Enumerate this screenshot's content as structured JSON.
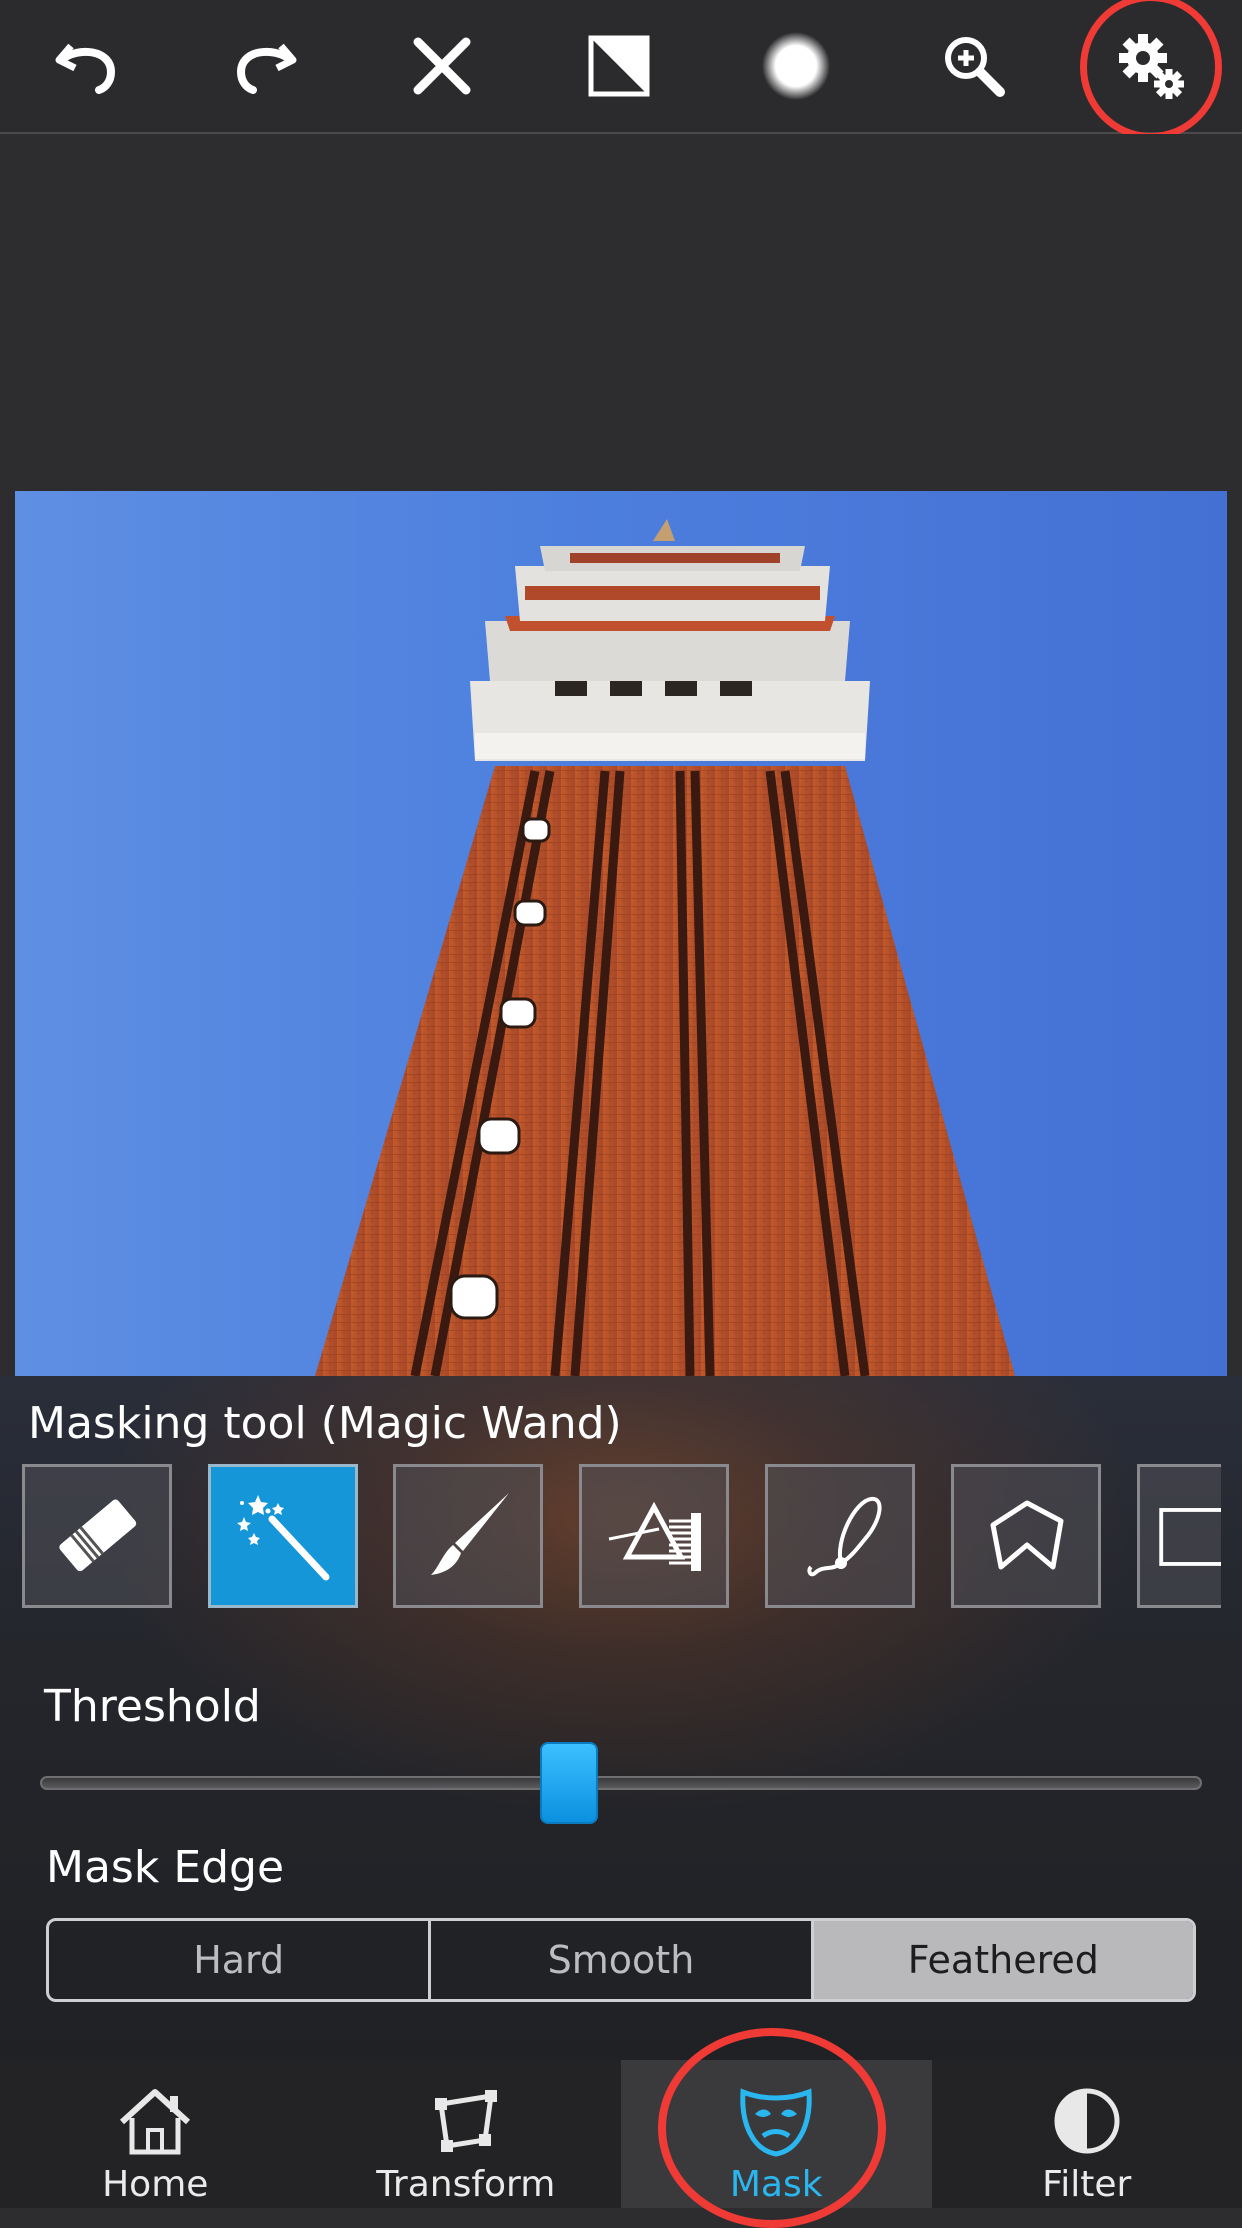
{
  "toolbar": {
    "buttons": [
      {
        "name": "undo-icon"
      },
      {
        "name": "redo-icon"
      },
      {
        "name": "close-icon"
      },
      {
        "name": "invert-mask-icon"
      },
      {
        "name": "brush-softness-icon"
      },
      {
        "name": "zoom-in-icon"
      },
      {
        "name": "settings-gears-icon"
      }
    ],
    "highlighted": "settings-gears-icon"
  },
  "panel": {
    "tool_title": "Masking tool (Magic Wand)",
    "tools": [
      {
        "name": "eraser-icon",
        "active": false
      },
      {
        "name": "magic-wand-icon",
        "active": true
      },
      {
        "name": "brush-icon",
        "active": false
      },
      {
        "name": "color-range-icon",
        "active": false
      },
      {
        "name": "lasso-icon",
        "active": false
      },
      {
        "name": "polygon-icon",
        "active": false
      },
      {
        "name": "rectangle-icon",
        "active": false
      }
    ],
    "threshold_label": "Threshold",
    "threshold_value": 0.455,
    "mask_edge_label": "Mask Edge",
    "mask_edge_options": [
      "Hard",
      "Smooth",
      "Feathered"
    ],
    "mask_edge_selected": "Feathered"
  },
  "nav": {
    "items": [
      {
        "label": "Home",
        "icon": "home-icon"
      },
      {
        "label": "Transform",
        "icon": "transform-icon"
      },
      {
        "label": "Mask",
        "icon": "mask-icon"
      },
      {
        "label": "Filter",
        "icon": "filter-icon"
      }
    ],
    "active": "Mask"
  },
  "colors": {
    "accent": "#2ab6ee",
    "highlight_ring": "#ef3a35",
    "sky": "#4d7fde",
    "brick": "#b8532a"
  }
}
